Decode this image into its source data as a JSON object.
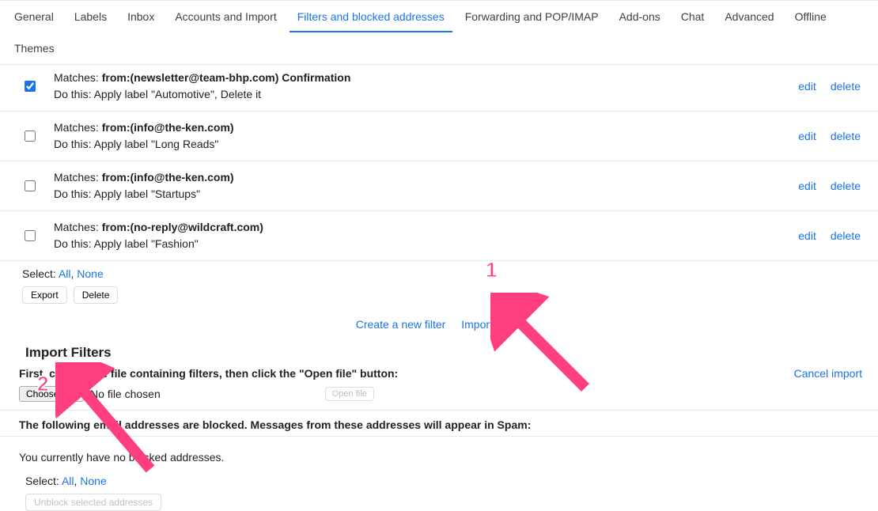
{
  "tabs": {
    "general": "General",
    "labels": "Labels",
    "inbox": "Inbox",
    "accounts": "Accounts and Import",
    "filters": "Filters and blocked addresses",
    "forwarding": "Forwarding and POP/IMAP",
    "addons": "Add-ons",
    "chat": "Chat",
    "advanced": "Advanced",
    "offline": "Offline",
    "themes": "Themes"
  },
  "filters": [
    {
      "matches_label": "Matches:",
      "criteria": "from:(newsletter@team-bhp.com) Confirmation",
      "action": "Do this: Apply label \"Automotive\", Delete it",
      "edit": "edit",
      "delete": "delete",
      "checked": true
    },
    {
      "matches_label": "Matches:",
      "criteria": "from:(info@the-ken.com)",
      "action": "Do this: Apply label \"Long Reads\"",
      "edit": "edit",
      "delete": "delete",
      "checked": false
    },
    {
      "matches_label": "Matches:",
      "criteria": "from:(info@the-ken.com)",
      "action": "Do this: Apply label \"Startups\"",
      "edit": "edit",
      "delete": "delete",
      "checked": false
    },
    {
      "matches_label": "Matches:",
      "criteria": "from:(no-reply@wildcraft.com)",
      "action": "Do this: Apply label \"Fashion\"",
      "edit": "edit",
      "delete": "delete",
      "checked": false
    }
  ],
  "select": {
    "label": "Select:",
    "all": "All",
    "none": "None",
    "sep": ", "
  },
  "buttons": {
    "export": "Export",
    "delete": "Delete"
  },
  "center": {
    "create": "Create a new filter",
    "import": "Import filters"
  },
  "import_section": {
    "title": "Import Filters",
    "instructions": "First, choose the file containing filters, then click the \"Open file\" button:",
    "cancel": "Cancel import",
    "choose_file": "Choose File",
    "no_file": "No file chosen",
    "open_file": "Open file"
  },
  "blocked": {
    "header": "The following email addresses are blocked. Messages from these addresses will appear in Spam:",
    "empty": "You currently have no blocked addresses.",
    "unblock": "Unblock selected addresses"
  },
  "annotations": {
    "one": "1",
    "two": "2"
  }
}
